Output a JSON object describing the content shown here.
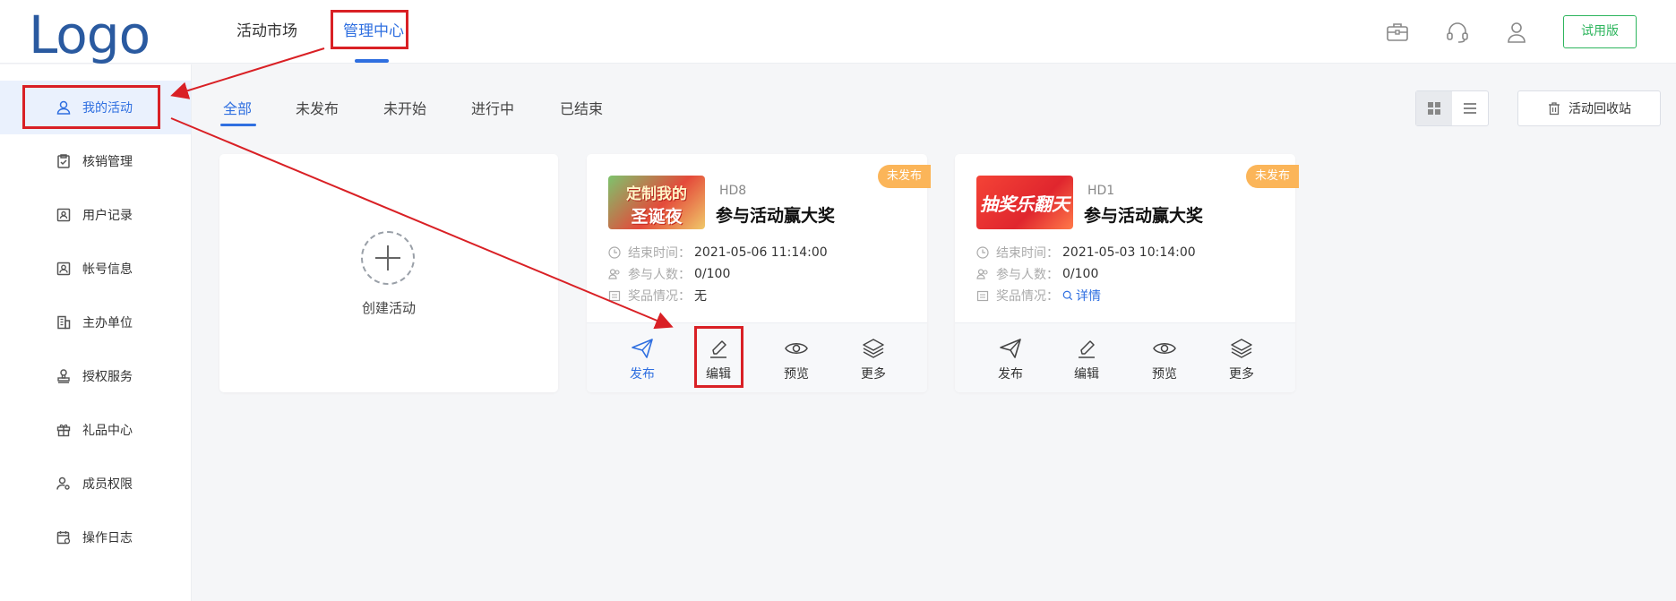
{
  "header": {
    "logo": "Logo",
    "nav": [
      {
        "label": "活动市场"
      },
      {
        "label": "管理中心"
      }
    ],
    "trial_label": "试用版"
  },
  "sidebar": {
    "items": [
      {
        "label": "我的活动",
        "icon": "user-icon"
      },
      {
        "label": "核销管理",
        "icon": "clipboard-check-icon"
      },
      {
        "label": "用户记录",
        "icon": "user-card-icon"
      },
      {
        "label": "帐号信息",
        "icon": "id-card-icon"
      },
      {
        "label": "主办单位",
        "icon": "building-icon"
      },
      {
        "label": "授权服务",
        "icon": "stamp-icon"
      },
      {
        "label": "礼品中心",
        "icon": "gift-icon"
      },
      {
        "label": "成员权限",
        "icon": "user-gear-icon"
      },
      {
        "label": "操作日志",
        "icon": "calendar-log-icon"
      }
    ]
  },
  "tabs": [
    {
      "label": "全部"
    },
    {
      "label": "未发布"
    },
    {
      "label": "未开始"
    },
    {
      "label": "进行中"
    },
    {
      "label": "已结束"
    }
  ],
  "recycle_label": "活动回收站",
  "create_label": "创建活动",
  "cards": [
    {
      "badge": "未发布",
      "id": "HD8",
      "title": "参与活动赢大奖",
      "thumb_line1": "定制我的",
      "thumb_line2": "圣诞夜",
      "end_label": "结束时间：",
      "end_value": "2021-05-06 11:14:00",
      "people_label": "参与人数：",
      "people_value": "0/100",
      "prize_label": "奖品情况：",
      "prize_value": "无",
      "actions": [
        "发布",
        "编辑",
        "预览",
        "更多"
      ]
    },
    {
      "badge": "未发布",
      "id": "HD1",
      "title": "参与活动赢大奖",
      "thumb_line1": "抽奖乐翻天",
      "end_label": "结束时间：",
      "end_value": "2021-05-03 10:14:00",
      "people_label": "参与人数：",
      "people_value": "0/100",
      "prize_label": "奖品情况：",
      "prize_link": "详情",
      "actions": [
        "发布",
        "编辑",
        "预览",
        "更多"
      ]
    }
  ],
  "colors": {
    "primary": "#2f6fe0",
    "trial_green": "#2db55d",
    "badge_orange": "#fbb559",
    "annotation_red": "#d92025"
  }
}
